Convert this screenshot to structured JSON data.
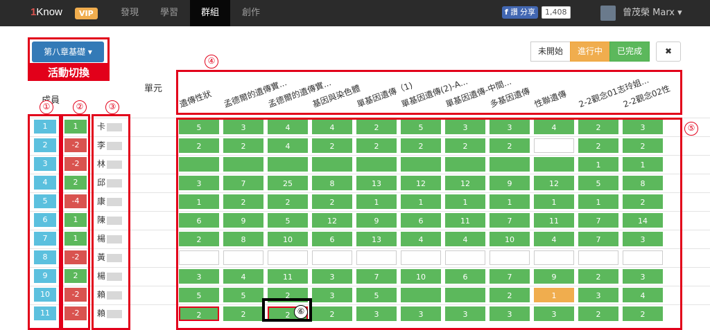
{
  "nav": {
    "logo_prefix": "1",
    "logo_text": "Know",
    "vip": "VIP",
    "items": [
      "發現",
      "學習",
      "群組",
      "創作"
    ],
    "fb_share": "讚",
    "fb_share2": "分享",
    "fb_count": "1,408",
    "user": "曾茂榮 Marx ▾"
  },
  "activity": {
    "label": "第八章基礎 ▾",
    "switch_label": "活動切換"
  },
  "headers": {
    "member": "成員",
    "unit": "單元"
  },
  "status": {
    "not_started": "未開始",
    "in_progress": "進行中",
    "done": "已完成",
    "close": "✖"
  },
  "annotations": [
    "①",
    "②",
    "③",
    "④",
    "⑤",
    "⑥"
  ],
  "units": [
    "遺傳性狀",
    "孟德爾的遺傳實...",
    "孟德爾的遺傳實...",
    "基因與染色體",
    "單基因遺傳（1)",
    "單基因遺傳(2)-A...",
    "單基因遺傳-中間...",
    "多基因遺傳",
    "性聯遺傳",
    "2-2觀念01志玲姐...",
    "2-2觀念02性"
  ],
  "members": [
    {
      "no": "1",
      "score": "1",
      "name": "卡"
    },
    {
      "no": "2",
      "score": "-2",
      "name": "李"
    },
    {
      "no": "3",
      "score": "-2",
      "name": "林"
    },
    {
      "no": "4",
      "score": "2",
      "name": "邱"
    },
    {
      "no": "5",
      "score": "-4",
      "name": "康"
    },
    {
      "no": "6",
      "score": "1",
      "name": "陳"
    },
    {
      "no": "7",
      "score": "1",
      "name": "楊"
    },
    {
      "no": "8",
      "score": "-2",
      "name": "黃"
    },
    {
      "no": "9",
      "score": "2",
      "name": "楊"
    },
    {
      "no": "10",
      "score": "-2",
      "name": "賴"
    },
    {
      "no": "11",
      "score": "-2",
      "name": "賴"
    }
  ],
  "grid": [
    [
      "5",
      "3",
      "4",
      "4",
      "2",
      "5",
      "3",
      "3",
      "4",
      "2",
      "3"
    ],
    [
      "2",
      "2",
      "4",
      "2",
      "2",
      "2",
      "2",
      "2",
      "",
      "2",
      "2"
    ],
    [
      "",
      "",
      "",
      "",
      "",
      "",
      "",
      "",
      "",
      "1",
      "1"
    ],
    [
      "3",
      "7",
      "25",
      "8",
      "13",
      "12",
      "12",
      "9",
      "12",
      "5",
      "8"
    ],
    [
      "1",
      "2",
      "2",
      "2",
      "1",
      "1",
      "1",
      "1",
      "1",
      "1",
      "2"
    ],
    [
      "6",
      "9",
      "5",
      "12",
      "9",
      "6",
      "11",
      "7",
      "11",
      "7",
      "14"
    ],
    [
      "2",
      "8",
      "10",
      "6",
      "13",
      "4",
      "4",
      "10",
      "4",
      "7",
      "3"
    ],
    [
      "",
      "",
      "",
      "",
      "",
      "",
      "",
      "",
      "",
      "",
      ""
    ],
    [
      "3",
      "4",
      "11",
      "3",
      "7",
      "10",
      "6",
      "7",
      "9",
      "2",
      "3"
    ],
    [
      "5",
      "5",
      "2",
      "3",
      "5",
      "",
      "",
      "2",
      "1",
      "3",
      "4"
    ],
    [
      "2",
      "2",
      "2",
      "2",
      "3",
      "3",
      "3",
      "3",
      "3",
      "2",
      "2"
    ]
  ],
  "grid_status": [
    [
      "g",
      "g",
      "g",
      "g",
      "g",
      "g",
      "g",
      "g",
      "g",
      "g",
      "g"
    ],
    [
      "g",
      "g",
      "g",
      "g",
      "g",
      "g",
      "g",
      "g",
      "w",
      "g",
      "g"
    ],
    [
      "g",
      "g",
      "g",
      "g",
      "g",
      "g",
      "g",
      "g",
      "g",
      "g",
      "g"
    ],
    [
      "g",
      "g",
      "g",
      "g",
      "g",
      "g",
      "g",
      "g",
      "g",
      "g",
      "g"
    ],
    [
      "g",
      "g",
      "g",
      "g",
      "g",
      "g",
      "g",
      "g",
      "g",
      "g",
      "g"
    ],
    [
      "g",
      "g",
      "g",
      "g",
      "g",
      "g",
      "g",
      "g",
      "g",
      "g",
      "g"
    ],
    [
      "g",
      "g",
      "g",
      "g",
      "g",
      "g",
      "g",
      "g",
      "g",
      "g",
      "g"
    ],
    [
      "w",
      "w",
      "w",
      "w",
      "w",
      "w",
      "w",
      "w",
      "w",
      "w",
      "w"
    ],
    [
      "g",
      "g",
      "g",
      "g",
      "g",
      "g",
      "g",
      "g",
      "g",
      "g",
      "g"
    ],
    [
      "g",
      "g",
      "g",
      "g",
      "g",
      "g",
      "g",
      "g",
      "o",
      "g",
      "g"
    ],
    [
      "g",
      "g",
      "g",
      "g",
      "g",
      "g",
      "g",
      "g",
      "g",
      "g",
      "g"
    ]
  ],
  "colors": {
    "green": "#5cb85c",
    "orange": "#f0ad4e",
    "blue": "#5bc0de",
    "red": "#d9534f",
    "annot": "#e2001a"
  }
}
